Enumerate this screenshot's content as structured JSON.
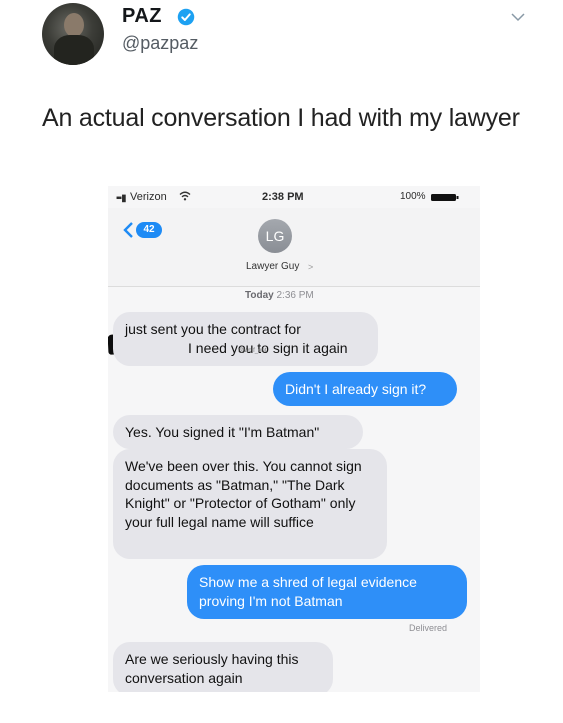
{
  "tweet": {
    "display_name": "PAZ",
    "handle": "@pazpaz",
    "text": "An actual conversation I had with my lawyer"
  },
  "phone": {
    "status_bar": {
      "carrier": "Verizon",
      "time": "2:38 PM",
      "battery": "100%"
    },
    "nav": {
      "back_count": "42",
      "contact_initials": "LG",
      "contact_name": "Lawyer Guy",
      "contact_chevron": ">"
    },
    "timestamp_day": "Today",
    "timestamp_time": "2:36 PM",
    "watermark": "@wolf_ent",
    "messages": [
      {
        "direction": "in",
        "lines": [
          "just sent you the contract for",
          "I need you to sign it again"
        ]
      },
      {
        "direction": "out",
        "text": "Didn't I already sign it?"
      },
      {
        "direction": "in",
        "text": "Yes. You signed it \"I'm Batman\""
      },
      {
        "direction": "in",
        "text": "We've been over this. You cannot sign documents as \"Batman,\" \"The Dark Knight\" or \"Protector of Gotham\" only your full legal name will suffice"
      },
      {
        "direction": "out",
        "text": "Show me a shred of legal evidence proving I'm not Batman"
      },
      {
        "direction": "in",
        "text": "Are we seriously having this conversation again"
      }
    ],
    "delivered_label": "Delivered"
  },
  "colors": {
    "verified": "#1da1f2",
    "imessage_blue": "#2e8ff8",
    "incoming_gray": "#e5e5ea"
  },
  "icons": [
    "verified-icon",
    "chevron-down-icon",
    "wifi-icon",
    "battery-icon",
    "back-chevron-icon"
  ]
}
